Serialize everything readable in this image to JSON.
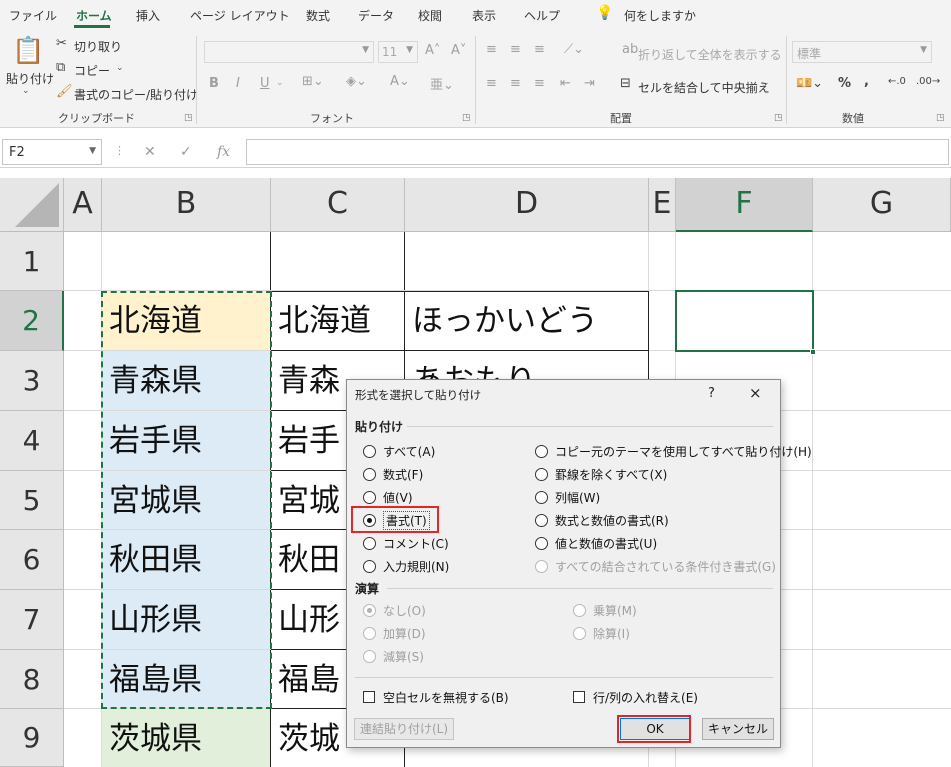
{
  "menu": {
    "tabs": [
      "ファイル",
      "ホーム",
      "挿入",
      "ページ レイアウト",
      "数式",
      "データ",
      "校閲",
      "表示",
      "ヘルプ"
    ],
    "active": "ホーム",
    "tell_me": "何をしますか"
  },
  "ribbon": {
    "clipboard": {
      "paste": "貼り付け",
      "cut": "切り取り",
      "copy": "コピー",
      "format_painter": "書式のコピー/貼り付け",
      "label": "クリップボード"
    },
    "font": {
      "size": "11",
      "bold": "B",
      "italic": "I",
      "underline": "U",
      "label": "フォント"
    },
    "alignment": {
      "wrap_text": "折り返して全体を表示する",
      "merge_center": "セルを結合して中央揃え",
      "label": "配置"
    },
    "number": {
      "format": "標準",
      "percent": "%",
      "comma": ",",
      "label": "数値"
    }
  },
  "formula_bar": {
    "name_box": "F2",
    "fx": "fx"
  },
  "sheet": {
    "columns": [
      "A",
      "B",
      "C",
      "D",
      "E",
      "F",
      "G"
    ],
    "selected_column": "F",
    "rows": [
      "1",
      "2",
      "3",
      "4",
      "5",
      "6",
      "7",
      "8",
      "9"
    ],
    "selected_row": "2",
    "cells": {
      "B2": "北海道",
      "C2": "北海道",
      "D2": "ほっかいどう",
      "B3": "青森県",
      "C3": "青森",
      "D3": "あおもり",
      "B4": "岩手県",
      "C4": "岩手",
      "B5": "宮城県",
      "C5": "宮城",
      "B6": "秋田県",
      "C6": "秋田",
      "B7": "山形県",
      "C7": "山形",
      "B8": "福島県",
      "C8": "福島",
      "B9": "茨城県",
      "C9": "茨城"
    },
    "colors": {
      "accent": "#217346",
      "fill_yellow": "#fff2cc",
      "fill_blue": "#ddebf7",
      "fill_green": "#e2efda"
    }
  },
  "dialog": {
    "title": "形式を選択して貼り付け",
    "help": "?",
    "close": "×",
    "paste_section": "貼り付け",
    "paste_options_left": [
      "すべて(A)",
      "数式(F)",
      "値(V)",
      "書式(T)",
      "コメント(C)",
      "入力規則(N)"
    ],
    "paste_options_right": [
      "コピー元のテーマを使用してすべて貼り付け(H)",
      "罫線を除くすべて(X)",
      "列幅(W)",
      "数式と数値の書式(R)",
      "値と数値の書式(U)",
      "すべての結合されている条件付き書式(G)"
    ],
    "selected_option": "書式(T)",
    "operation_section": "演算",
    "operation_left": [
      "なし(O)",
      "加算(D)",
      "減算(S)"
    ],
    "operation_right": [
      "乗算(M)",
      "除算(I)"
    ],
    "skip_blanks": "空白セルを無視する(B)",
    "transpose": "行/列の入れ替え(E)",
    "paste_link": "連結貼り付け(L)",
    "ok": "OK",
    "cancel": "キャンセル"
  }
}
